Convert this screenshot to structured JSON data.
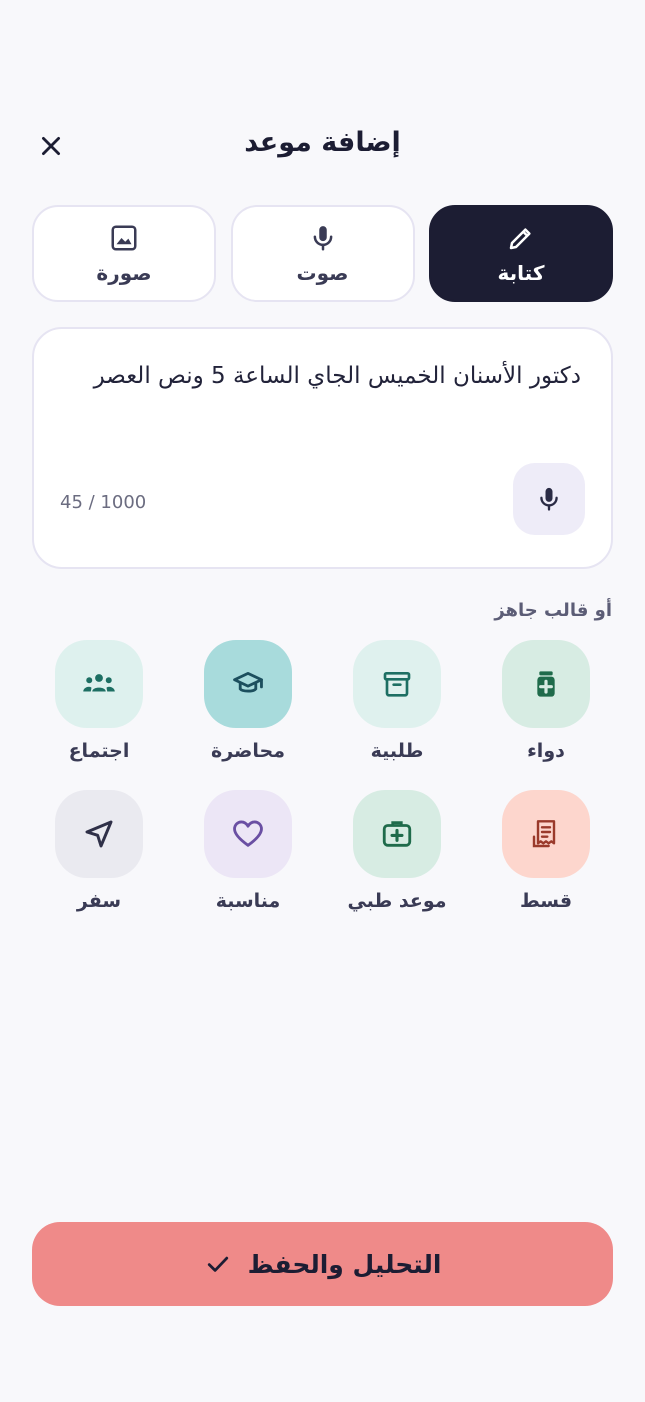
{
  "header": {
    "title": "إضافة موعد",
    "close_icon": "close-icon"
  },
  "modes": [
    {
      "label": "كتابة",
      "icon": "pencil-icon",
      "active": true
    },
    {
      "label": "صوت",
      "icon": "microphone-icon",
      "active": false
    },
    {
      "label": "صورة",
      "icon": "image-icon",
      "active": false
    }
  ],
  "input": {
    "value": "دكتور الأسنان الخميس الجاي الساعة 5 ونص العصر",
    "counter": "45 / 1000",
    "mic_icon": "microphone-icon"
  },
  "templates_label": "أو قالب جاهز",
  "templates": [
    {
      "label": "دواء",
      "icon": "medicine-icon",
      "bg": "#d7ece3",
      "fg": "#1f6b4b"
    },
    {
      "label": "طلبية",
      "icon": "archive-box-icon",
      "bg": "#dff1ee",
      "fg": "#1d6f63"
    },
    {
      "label": "محاضرة",
      "icon": "graduation-cap-icon",
      "bg": "#a8dbdc",
      "fg": "#1c4f5e"
    },
    {
      "label": "اجتماع",
      "icon": "group-icon",
      "bg": "#def1ee",
      "fg": "#1d6f63"
    },
    {
      "label": "قسط",
      "icon": "receipt-icon",
      "bg": "#fdd6cd",
      "fg": "#9a3a2b"
    },
    {
      "label": "موعد طبي",
      "icon": "first-aid-kit-icon",
      "bg": "#d7ece3",
      "fg": "#1f6b4b"
    },
    {
      "label": "مناسبة",
      "icon": "heart-icon",
      "bg": "#ece6f6",
      "fg": "#6a4fa3"
    },
    {
      "label": "سفر",
      "icon": "navigation-arrow-icon",
      "bg": "#eaeaf0",
      "fg": "#2f3048"
    }
  ],
  "save": {
    "label": "التحليل والحفظ",
    "icon": "check-icon"
  },
  "colors": {
    "primary": "#1c1d33",
    "accent": "#ef8a89",
    "background": "#f8f8fb"
  }
}
